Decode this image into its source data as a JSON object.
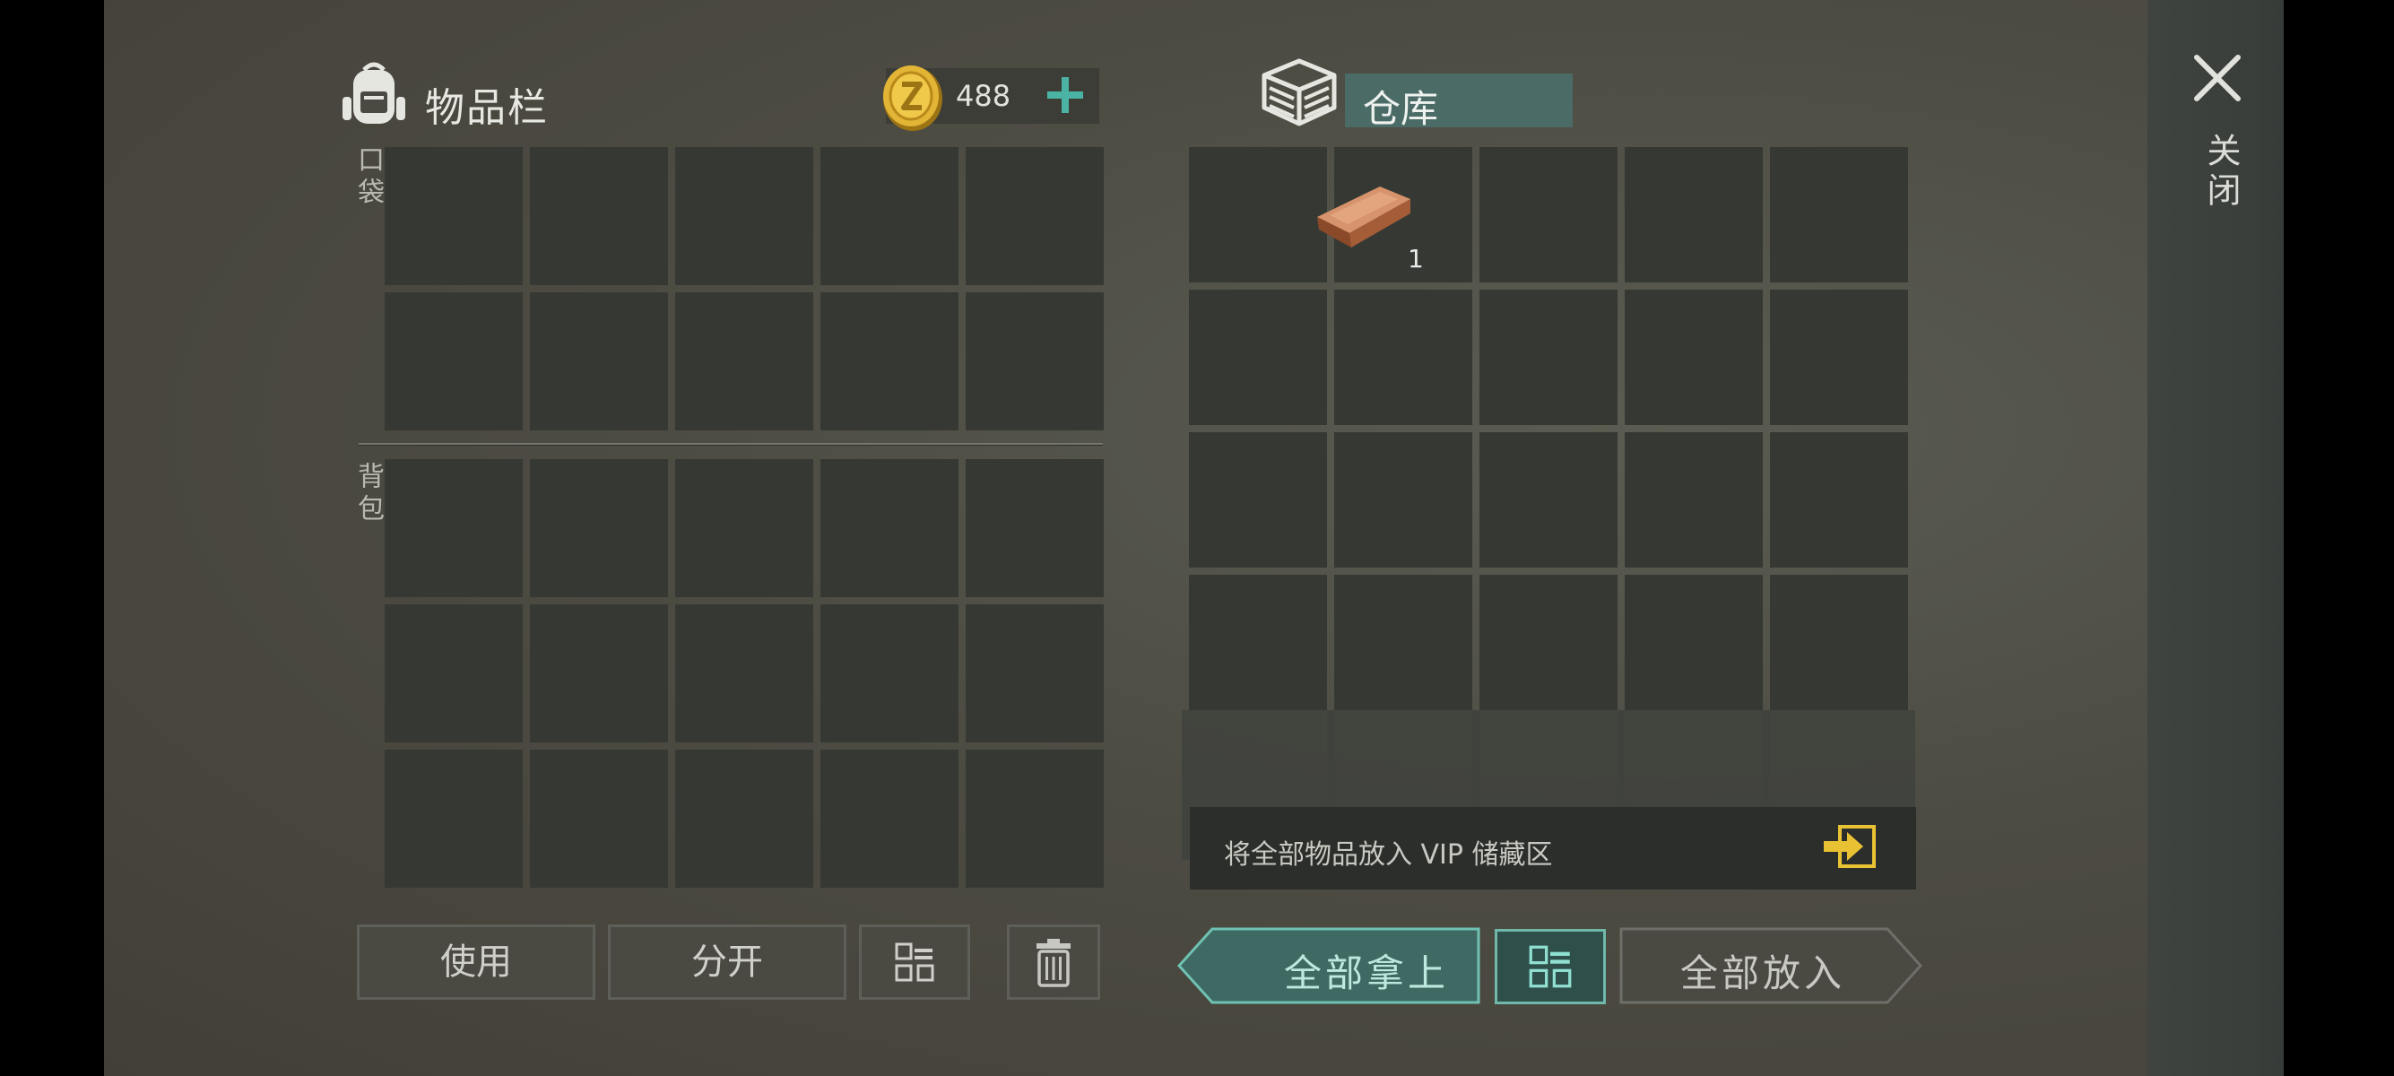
{
  "inventory": {
    "title": "物品栏",
    "coins": "488",
    "pocket_label": "口袋",
    "backpack_label": "背包",
    "pocket_slots": 10,
    "backpack_slots": 15
  },
  "warehouse": {
    "title": "仓库",
    "slots": 25,
    "items": [
      {
        "slot": 0,
        "icon": "copper-ingot-icon",
        "qty": "1"
      }
    ],
    "vip_text": "将全部物品放入 VIP 储藏区"
  },
  "buttons": {
    "use": "使用",
    "split": "分开",
    "take_all": "全部拿上",
    "put_all": "全部放入"
  },
  "close_label": "关闭",
  "colors": {
    "accent_teal": "#4b8f86",
    "title_bg": "#4b6b67",
    "vip_arrow": "#e9c234"
  }
}
